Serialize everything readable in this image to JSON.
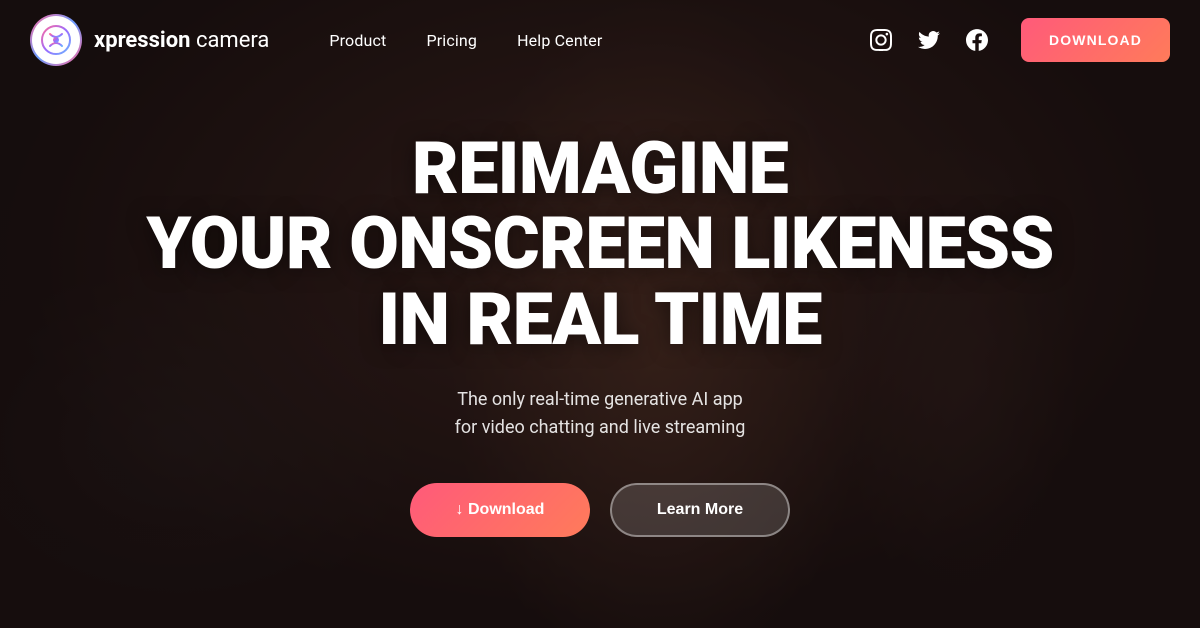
{
  "brand": {
    "name_part1": "xpression",
    "name_part2": " camera"
  },
  "nav": {
    "links": [
      {
        "label": "Product",
        "id": "product"
      },
      {
        "label": "Pricing",
        "id": "pricing"
      },
      {
        "label": "Help Center",
        "id": "help-center"
      }
    ],
    "download_label": "DOWNLOAD"
  },
  "social": {
    "icons": [
      "instagram",
      "twitter",
      "facebook"
    ]
  },
  "hero": {
    "title_line1": "REIMAGINE",
    "title_line2": "YOUR ONSCREEN LIKENESS",
    "title_line3": "IN REAL TIME",
    "subtitle_line1": "The only real-time generative AI app",
    "subtitle_line2": "for video chatting and live streaming",
    "cta_primary": "↓ Download",
    "cta_secondary": "Learn More"
  }
}
